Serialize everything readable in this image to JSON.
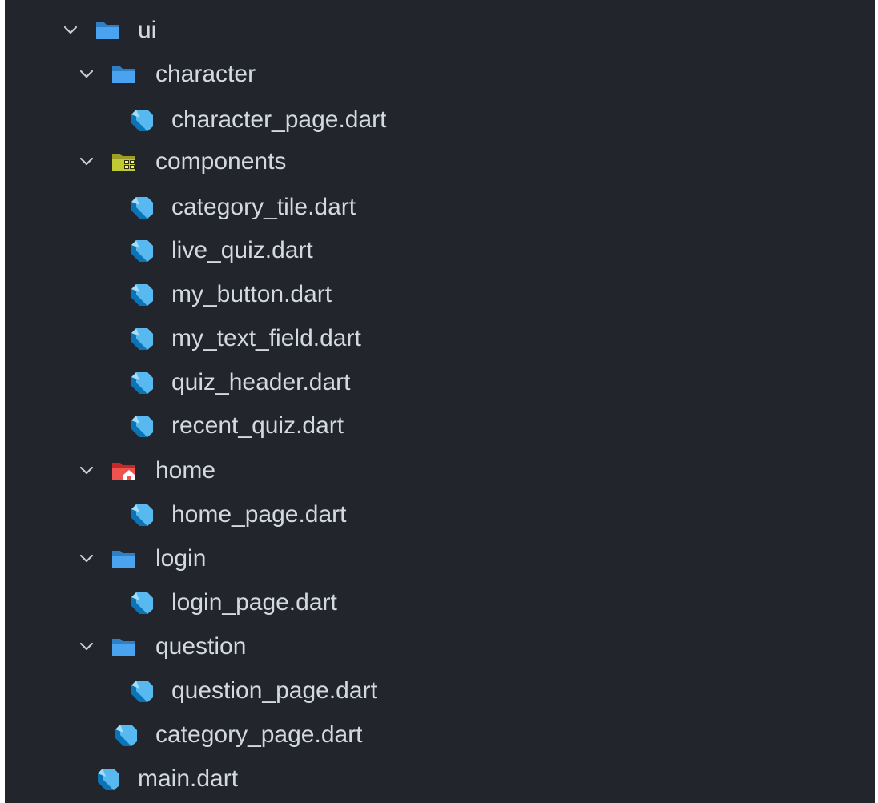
{
  "tree": [
    {
      "label": "ui",
      "kind": "folder",
      "icon": "folder-open-icon",
      "expanded": true,
      "depth": 0
    },
    {
      "label": "character",
      "kind": "folder",
      "icon": "folder-open-icon",
      "expanded": true,
      "depth": 1
    },
    {
      "label": "character_page.dart",
      "kind": "file",
      "icon": "dart-file-icon",
      "depth": 2
    },
    {
      "label": "components",
      "kind": "folder",
      "icon": "components-folder-icon",
      "expanded": true,
      "depth": 1
    },
    {
      "label": "category_tile.dart",
      "kind": "file",
      "icon": "dart-file-icon",
      "depth": 2
    },
    {
      "label": "live_quiz.dart",
      "kind": "file",
      "icon": "dart-file-icon",
      "depth": 2
    },
    {
      "label": "my_button.dart",
      "kind": "file",
      "icon": "dart-file-icon",
      "depth": 2
    },
    {
      "label": "my_text_field.dart",
      "kind": "file",
      "icon": "dart-file-icon",
      "depth": 2
    },
    {
      "label": "quiz_header.dart",
      "kind": "file",
      "icon": "dart-file-icon",
      "depth": 2
    },
    {
      "label": "recent_quiz.dart",
      "kind": "file",
      "icon": "dart-file-icon",
      "depth": 2
    },
    {
      "label": "home",
      "kind": "folder",
      "icon": "home-folder-icon",
      "expanded": true,
      "depth": 1
    },
    {
      "label": "home_page.dart",
      "kind": "file",
      "icon": "dart-file-icon",
      "depth": 2
    },
    {
      "label": "login",
      "kind": "folder",
      "icon": "folder-open-icon",
      "expanded": true,
      "depth": 1
    },
    {
      "label": "login_page.dart",
      "kind": "file",
      "icon": "dart-file-icon",
      "depth": 2
    },
    {
      "label": "question",
      "kind": "folder",
      "icon": "folder-open-icon",
      "expanded": true,
      "depth": 1
    },
    {
      "label": "question_page.dart",
      "kind": "file",
      "icon": "dart-file-icon",
      "depth": 2
    },
    {
      "label": "category_page.dart",
      "kind": "file",
      "icon": "dart-file-icon",
      "depth": 1
    },
    {
      "label": "main.dart",
      "kind": "file",
      "icon": "dart-file-icon",
      "depth": 0
    }
  ],
  "colors": {
    "background": "#22252b",
    "text": "#d4d8df",
    "chevron": "#c7ccd4",
    "folder_blue": "#4aa3ee",
    "folder_components": "#c0ca33",
    "folder_home": "#ef5350",
    "dart_dark": "#0b74b6",
    "dart_light": "#58b9f0"
  }
}
